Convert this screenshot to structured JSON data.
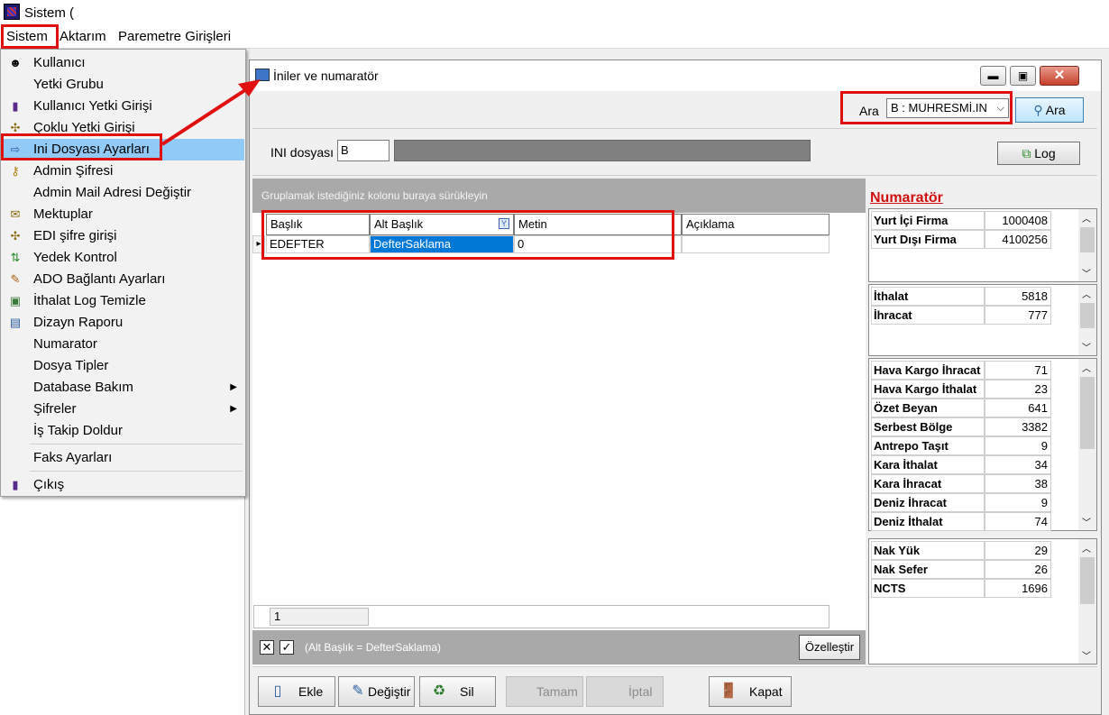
{
  "app": {
    "title": "Sistem ("
  },
  "menubar": {
    "sistem": "Sistem",
    "aktarim": "Aktarım",
    "parametre": "Paremetre Girişleri"
  },
  "dropdown": {
    "items": [
      {
        "label": "Kullanıcı",
        "icon": "user-icon"
      },
      {
        "label": "Yetki Grubu",
        "icon": ""
      },
      {
        "label": "Kullanıcı Yetki Girişi",
        "icon": "tube-icon"
      },
      {
        "label": "Çoklu Yetki Girişi",
        "icon": "key-cross-icon"
      },
      {
        "label": "Ini Dosyası  Ayarları",
        "icon": "ini-icon"
      },
      {
        "label": "Admin Şifresi",
        "icon": "key-icon"
      },
      {
        "label": "Admin Mail Adresi Değiştir",
        "icon": ""
      },
      {
        "label": "Mektuplar",
        "icon": "letter-icon"
      },
      {
        "label": "EDI şifre girişi",
        "icon": "key-cross-icon"
      },
      {
        "label": "Yedek Kontrol",
        "icon": "backup-icon"
      },
      {
        "label": "ADO Bağlantı Ayarları",
        "icon": "connection-icon"
      },
      {
        "label": "İthalat Log Temizle",
        "icon": "clean-icon"
      },
      {
        "label": "Dizayn Raporu",
        "icon": "report-icon"
      },
      {
        "label": "Numarator",
        "icon": ""
      },
      {
        "label": "Dosya Tipler",
        "icon": ""
      },
      {
        "label": "Database Bakım",
        "icon": ""
      },
      {
        "label": "Şifreler",
        "icon": ""
      },
      {
        "label": "İş Takip Doldur",
        "icon": ""
      },
      {
        "label": "Faks Ayarları",
        "icon": ""
      },
      {
        "label": "Çıkış",
        "icon": "exit-icon"
      }
    ]
  },
  "window": {
    "title": "İniler ve numaratör"
  },
  "search": {
    "label": "Ara",
    "combo_value": "B : MUHRESMİ.IN",
    "button": "Ara"
  },
  "ini": {
    "label": "INI dosyası",
    "value": "B",
    "log_button": "Log"
  },
  "grid": {
    "group_hint": "Gruplamak istediğiniz kolonu buraya sürükleyin",
    "columns": [
      "Başlık",
      "Alt Başlık",
      "Metin",
      "Açıklama"
    ],
    "row": [
      "EDEFTER",
      "DefterSaklama",
      "0",
      ""
    ],
    "footer_value": "1",
    "filter_text": "(Alt Başlık = DefterSaklama)",
    "customize_button": "Özelleştir"
  },
  "buttons": {
    "ekle": "Ekle",
    "degistir": "Değiştir",
    "sil": "Sil",
    "tamam": "Tamam",
    "iptal": "İptal",
    "kapat": "Kapat"
  },
  "numarator": {
    "title": "Numaratör",
    "box1": [
      {
        "k": "Yurt İçi Firma",
        "v": "1000408"
      },
      {
        "k": "Yurt Dışı Firma",
        "v": "4100256"
      }
    ],
    "box2": [
      {
        "k": "İthalat",
        "v": "5818"
      },
      {
        "k": "İhracat",
        "v": "777"
      }
    ],
    "box3": [
      {
        "k": "Hava Kargo İhracat",
        "v": "71"
      },
      {
        "k": "Hava Kargo İthalat",
        "v": "23"
      },
      {
        "k": "Özet Beyan",
        "v": "641"
      },
      {
        "k": "Serbest Bölge",
        "v": "3382"
      },
      {
        "k": "Antrepo Taşıt",
        "v": "9"
      },
      {
        "k": "Kara İthalat",
        "v": "34"
      },
      {
        "k": "Kara İhracat",
        "v": "38"
      },
      {
        "k": "Deniz İhracat",
        "v": "9"
      },
      {
        "k": "Deniz İthalat",
        "v": "74"
      }
    ],
    "box4": [
      {
        "k": "Nak Yük",
        "v": "29"
      },
      {
        "k": "Nak Sefer",
        "v": "26"
      },
      {
        "k": "NCTS",
        "v": "1696"
      }
    ]
  },
  "colors": {
    "highlight": "#e01010",
    "selection": "#0078d7",
    "menu_selection": "#91c9f7",
    "numarator_title": "#d01010"
  }
}
